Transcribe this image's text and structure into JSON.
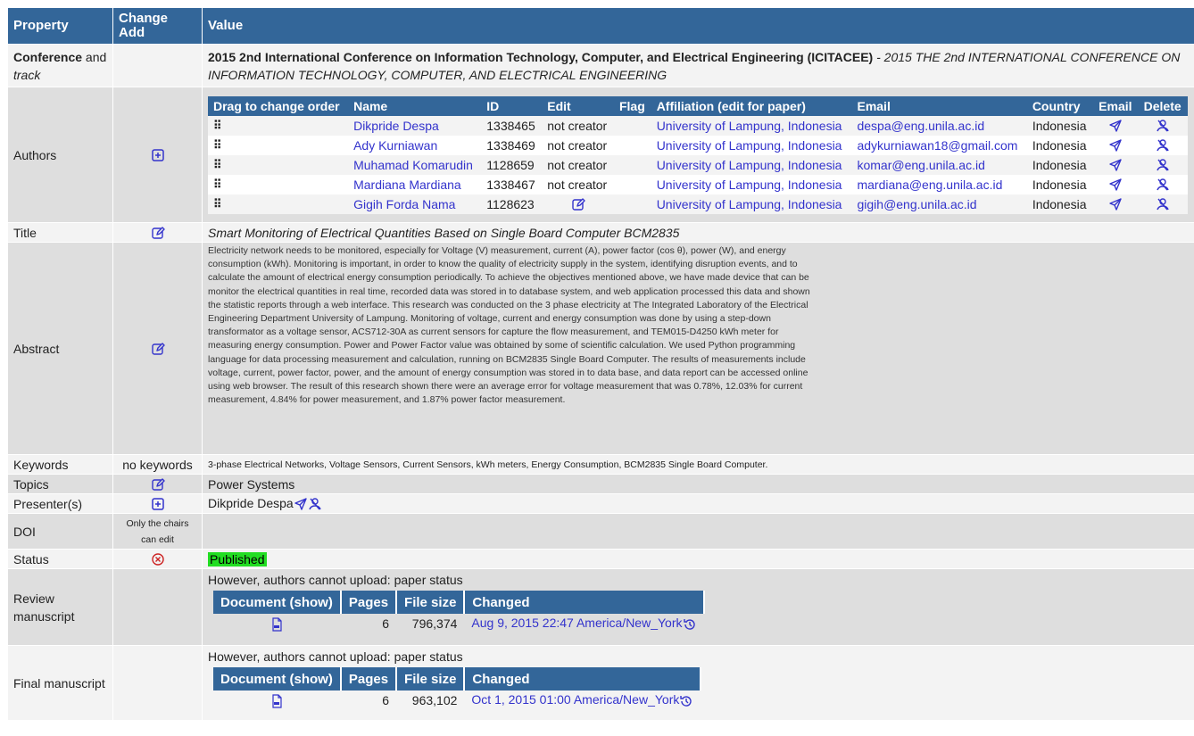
{
  "headers": {
    "property": "Property",
    "change_add": "Change Add",
    "value": "Value"
  },
  "conference": {
    "label_bold": "Conference",
    "label_rest": " and",
    "label_italic": "track",
    "title_bold": "2015 2nd International Conference on Information Technology, Computer, and Electrical Engineering (ICITACEE)",
    "title_italic": " - 2015 THE 2nd INTERNATIONAL CONFERENCE ON INFORMATION TECHNOLOGY, COMPUTER, AND ELECTRICAL ENGINEERING"
  },
  "authors": {
    "label": "Authors",
    "columns": [
      "Drag to change order",
      "Name",
      "ID",
      "Edit",
      "Flag",
      "Affiliation (edit for paper)",
      "Email",
      "Country",
      "Email",
      "Delete"
    ],
    "grip": "⠿",
    "rows": [
      {
        "name": "Dikpride Despa",
        "id": "1338465",
        "edit": "not creator",
        "affiliation": "University of Lampung, Indonesia",
        "email": "despa@eng.unila.ac.id",
        "country": "Indonesia"
      },
      {
        "name": "Ady Kurniawan",
        "id": "1338469",
        "edit": "not creator",
        "affiliation": "University of Lampung, Indonesia",
        "email": "adykurniawan18@gmail.com",
        "country": "Indonesia"
      },
      {
        "name": "Muhamad Komarudin",
        "id": "1128659",
        "edit": "not creator",
        "affiliation": "University of Lampung, Indonesia",
        "email": "komar@eng.unila.ac.id",
        "country": "Indonesia"
      },
      {
        "name": "Mardiana Mardiana",
        "id": "1338467",
        "edit": "not creator",
        "affiliation": "University of Lampung, Indonesia",
        "email": "mardiana@eng.unila.ac.id",
        "country": "Indonesia"
      },
      {
        "name": "Gigih Forda Nama",
        "id": "1128623",
        "edit": "",
        "affiliation": "University of Lampung, Indonesia",
        "email": "gigih@eng.unila.ac.id",
        "country": "Indonesia"
      }
    ]
  },
  "title": {
    "label": "Title",
    "value": "Smart Monitoring of Electrical Quantities Based on Single Board Computer BCM2835"
  },
  "abstract": {
    "label": "Abstract",
    "value": "Electricity network needs to be monitored, especially for Voltage (V) measurement, current (A), power factor (cos θ), power (W), and energy consumption (kWh). Monitoring is important, in order to know the quality of electricity supply in the system, identifying disruption events, and to calculate the amount of electrical energy consumption periodically. To achieve the objectives mentioned above, we have made device that can be monitor the electrical quantities in real time, recorded data was stored in to database system, and web application processed this data and shown the statistic reports through a web interface. This research was conducted on the 3 phase electricity at The Integrated Laboratory of the Electrical Engineering Department University of Lampung. Monitoring of voltage, current and energy consumption was done by using a step-down transformator as a voltage sensor, ACS712-30A as current sensors for capture the flow measurement, and TEM015-D4250 kWh meter for measuring energy consumption. Power and Power Factor value was obtained by some of scientific calculation. We used Python programming language for data processing measurement and calculation, running on BCM2835 Single Board Computer. The results of measurements include voltage, current, power factor, power, and the amount of energy consumption was stored in to data base, and data report can be accessed online using web browser. The result of this research shown there were an average error for voltage measurement that was 0.78%, 12.03% for current measurement, 4.84% for power measurement, and 1.87% power factor measurement."
  },
  "keywords": {
    "label": "Keywords",
    "change": "no keywords",
    "value": "3-phase Electrical Networks, Voltage Sensors, Current Sensors, kWh meters, Energy Consumption, BCM2835 Single Board Computer."
  },
  "topics": {
    "label": "Topics",
    "value": "Power Systems"
  },
  "presenters": {
    "label": "Presenter(s)",
    "value": "Dikpride Despa"
  },
  "doi": {
    "label": "DOI",
    "change": "Only the chairs can edit",
    "value": ""
  },
  "status": {
    "label": "Status",
    "value": "Published",
    "color": "#22dd22"
  },
  "review": {
    "label": "Review manuscript",
    "note": "However, authors cannot upload: paper status",
    "columns": [
      "Document (show)",
      "Pages",
      "File size",
      "Changed"
    ],
    "pages": "6",
    "size": "796,374",
    "changed": "Aug 9, 2015 22:47 America/New_York"
  },
  "final": {
    "label": "Final manuscript",
    "note": "However, authors cannot upload: paper status",
    "columns": [
      "Document (show)",
      "Pages",
      "File size",
      "Changed"
    ],
    "pages": "6",
    "size": "963,102",
    "changed": "Oct 1, 2015 01:00 America/New_York"
  },
  "colors": {
    "header": "#336699",
    "link": "#3333cc",
    "row_light": "#f3f3f3",
    "row_dark": "#dedede",
    "status_published": "#22dd22",
    "error": "#cc2222"
  }
}
